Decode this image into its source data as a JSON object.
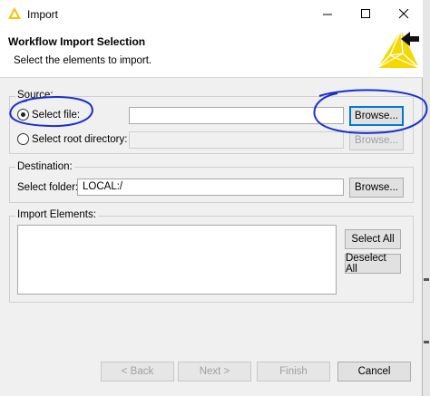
{
  "window": {
    "title": "Import"
  },
  "banner": {
    "title": "Workflow Import Selection",
    "subtitle": "Select the elements to import."
  },
  "source": {
    "label": "Source:",
    "select_file_label": "Select file:",
    "select_file_value": "",
    "select_file_checked": true,
    "browse_file_label": "Browse...",
    "select_root_label": "Select root directory:",
    "select_root_value": "",
    "browse_root_label": "Browse..."
  },
  "destination": {
    "label": "Destination:",
    "folder_label": "Select folder:",
    "folder_value": "LOCAL:/",
    "browse_label": "Browse..."
  },
  "import_elements": {
    "label": "Import Elements:",
    "select_all_label": "Select All",
    "deselect_all_label": "Deselect All"
  },
  "footer": {
    "back_label": "< Back",
    "next_label": "Next >",
    "finish_label": "Finish",
    "cancel_label": "Cancel"
  },
  "colors": {
    "accent_focus": "#0078d7",
    "annotation_ink": "#1b2fd0",
    "logo_yellow": "#f5d800"
  },
  "icons": {
    "app": "knime-triangle-icon",
    "minimize": "minimize-icon",
    "maximize": "maximize-icon",
    "close": "close-icon",
    "banner": "knime-logo-icon"
  }
}
